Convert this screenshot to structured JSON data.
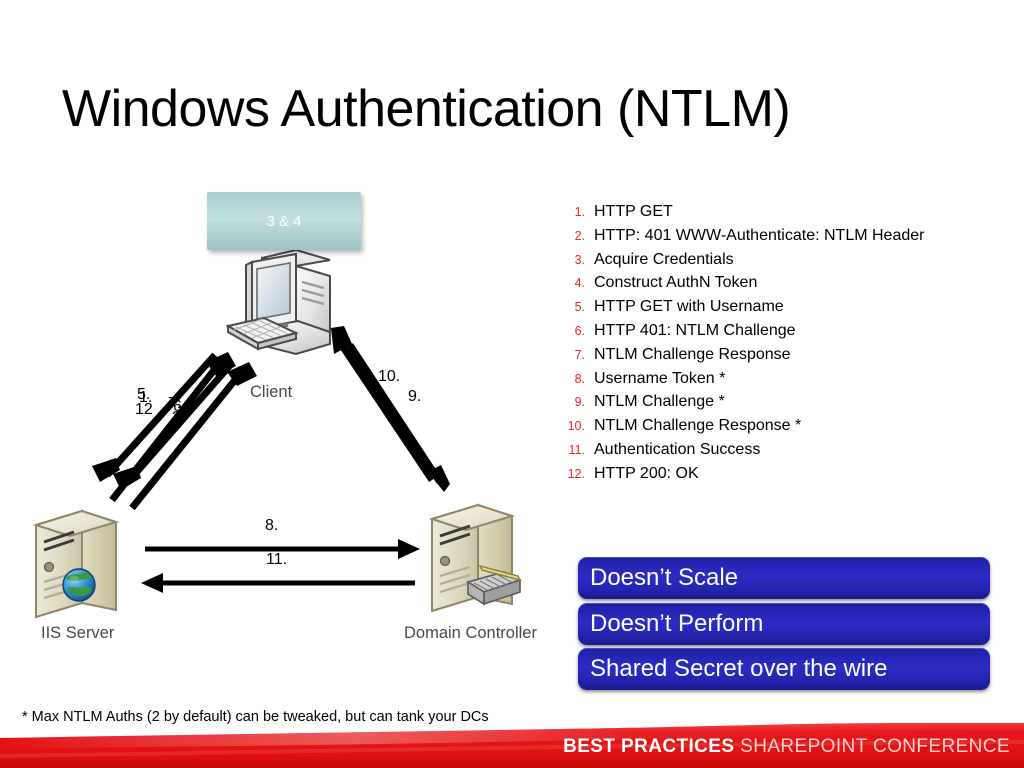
{
  "slide": {
    "title": "Windows Authentication (NTLM)",
    "footnote": "* Max NTLM Auths (2 by default) can be tweaked, but can tank your DCs"
  },
  "steps": [
    {
      "num": "1.",
      "text": "HTTP GET"
    },
    {
      "num": "2.",
      "text": "HTTP: 401 WWW-Authenticate: NTLM Header"
    },
    {
      "num": "3.",
      "text": "Acquire Credentials"
    },
    {
      "num": "4.",
      "text": "Construct AuthN Token"
    },
    {
      "num": "5.",
      "text": "HTTP GET with Username"
    },
    {
      "num": "6.",
      "text": "HTTP 401: NTLM Challenge"
    },
    {
      "num": "7.",
      "text": "NTLM Challenge Response"
    },
    {
      "num": "8.",
      "text": "Username Token *"
    },
    {
      "num": "9.",
      "text": "NTLM Challenge *"
    },
    {
      "num": "10.",
      "text": "NTLM Challenge Response *"
    },
    {
      "num": "11.",
      "text": "Authentication Success"
    },
    {
      "num": "12.",
      "text": "HTTP 200: OK"
    }
  ],
  "callouts": [
    {
      "label": "Doesn’t Scale"
    },
    {
      "label": "Doesn’t Perform"
    },
    {
      "label": "Shared Secret over the wire"
    }
  ],
  "diagram": {
    "teal_box_label": "3 & 4",
    "nodes": {
      "client": "Client",
      "iis_server": "IIS Server",
      "domain_controller": "Domain Controller"
    },
    "arrow_labels": {
      "client_iis_5": "5.",
      "client_iis_1": "1.",
      "client_iis_12": "12",
      "client_iis_7": "7.",
      "client_iis_6": "6.",
      "client_iis_2": "2.",
      "client_dc_10": "10.",
      "client_dc_9": "9.",
      "iis_dc_8": "8.",
      "dc_iis_11": "11."
    }
  },
  "footer": {
    "brand_bold": "BEST PRACTICES",
    "brand_light": "SHAREPOINT CONFERENCE"
  },
  "colors": {
    "step_number": "#e8242c",
    "callout_blue": "#2c2cc4",
    "footer_red": "#e8161b",
    "teal_box": "#b6d8d8",
    "node_caption": "#4a4a4a"
  }
}
